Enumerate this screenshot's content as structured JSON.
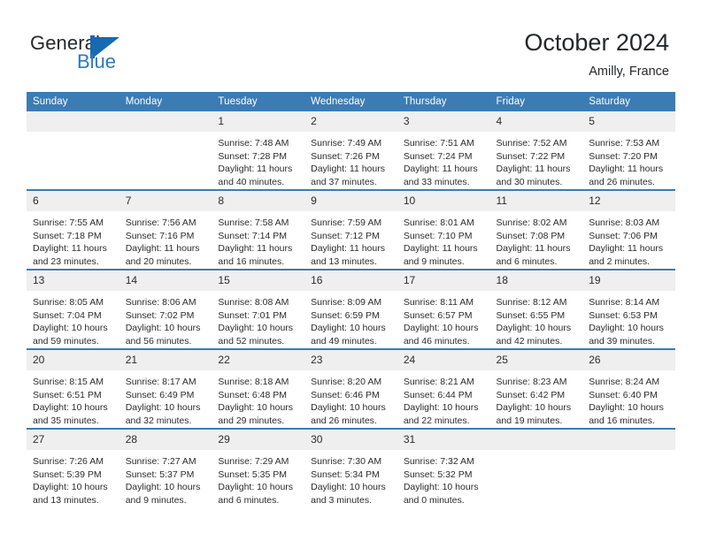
{
  "brand": {
    "name_part1": "General",
    "name_part2": "Blue",
    "logo_icon": "general-blue-triangle-logo",
    "accent_color": "#2a7ac0"
  },
  "header": {
    "title": "October 2024",
    "location": "Amilly, France",
    "header_bg_color": "#3b7cb5",
    "daynum_bg_color": "#efefef"
  },
  "weekday_headers": [
    "Sunday",
    "Monday",
    "Tuesday",
    "Wednesday",
    "Thursday",
    "Friday",
    "Saturday"
  ],
  "weeks": [
    [
      {
        "day": "",
        "lines": []
      },
      {
        "day": "",
        "lines": []
      },
      {
        "day": "1",
        "lines": [
          "Sunrise: 7:48 AM",
          "Sunset: 7:28 PM",
          "Daylight: 11 hours",
          "and 40 minutes."
        ]
      },
      {
        "day": "2",
        "lines": [
          "Sunrise: 7:49 AM",
          "Sunset: 7:26 PM",
          "Daylight: 11 hours",
          "and 37 minutes."
        ]
      },
      {
        "day": "3",
        "lines": [
          "Sunrise: 7:51 AM",
          "Sunset: 7:24 PM",
          "Daylight: 11 hours",
          "and 33 minutes."
        ]
      },
      {
        "day": "4",
        "lines": [
          "Sunrise: 7:52 AM",
          "Sunset: 7:22 PM",
          "Daylight: 11 hours",
          "and 30 minutes."
        ]
      },
      {
        "day": "5",
        "lines": [
          "Sunrise: 7:53 AM",
          "Sunset: 7:20 PM",
          "Daylight: 11 hours",
          "and 26 minutes."
        ]
      }
    ],
    [
      {
        "day": "6",
        "lines": [
          "Sunrise: 7:55 AM",
          "Sunset: 7:18 PM",
          "Daylight: 11 hours",
          "and 23 minutes."
        ]
      },
      {
        "day": "7",
        "lines": [
          "Sunrise: 7:56 AM",
          "Sunset: 7:16 PM",
          "Daylight: 11 hours",
          "and 20 minutes."
        ]
      },
      {
        "day": "8",
        "lines": [
          "Sunrise: 7:58 AM",
          "Sunset: 7:14 PM",
          "Daylight: 11 hours",
          "and 16 minutes."
        ]
      },
      {
        "day": "9",
        "lines": [
          "Sunrise: 7:59 AM",
          "Sunset: 7:12 PM",
          "Daylight: 11 hours",
          "and 13 minutes."
        ]
      },
      {
        "day": "10",
        "lines": [
          "Sunrise: 8:01 AM",
          "Sunset: 7:10 PM",
          "Daylight: 11 hours",
          "and 9 minutes."
        ]
      },
      {
        "day": "11",
        "lines": [
          "Sunrise: 8:02 AM",
          "Sunset: 7:08 PM",
          "Daylight: 11 hours",
          "and 6 minutes."
        ]
      },
      {
        "day": "12",
        "lines": [
          "Sunrise: 8:03 AM",
          "Sunset: 7:06 PM",
          "Daylight: 11 hours",
          "and 2 minutes."
        ]
      }
    ],
    [
      {
        "day": "13",
        "lines": [
          "Sunrise: 8:05 AM",
          "Sunset: 7:04 PM",
          "Daylight: 10 hours",
          "and 59 minutes."
        ]
      },
      {
        "day": "14",
        "lines": [
          "Sunrise: 8:06 AM",
          "Sunset: 7:02 PM",
          "Daylight: 10 hours",
          "and 56 minutes."
        ]
      },
      {
        "day": "15",
        "lines": [
          "Sunrise: 8:08 AM",
          "Sunset: 7:01 PM",
          "Daylight: 10 hours",
          "and 52 minutes."
        ]
      },
      {
        "day": "16",
        "lines": [
          "Sunrise: 8:09 AM",
          "Sunset: 6:59 PM",
          "Daylight: 10 hours",
          "and 49 minutes."
        ]
      },
      {
        "day": "17",
        "lines": [
          "Sunrise: 8:11 AM",
          "Sunset: 6:57 PM",
          "Daylight: 10 hours",
          "and 46 minutes."
        ]
      },
      {
        "day": "18",
        "lines": [
          "Sunrise: 8:12 AM",
          "Sunset: 6:55 PM",
          "Daylight: 10 hours",
          "and 42 minutes."
        ]
      },
      {
        "day": "19",
        "lines": [
          "Sunrise: 8:14 AM",
          "Sunset: 6:53 PM",
          "Daylight: 10 hours",
          "and 39 minutes."
        ]
      }
    ],
    [
      {
        "day": "20",
        "lines": [
          "Sunrise: 8:15 AM",
          "Sunset: 6:51 PM",
          "Daylight: 10 hours",
          "and 35 minutes."
        ]
      },
      {
        "day": "21",
        "lines": [
          "Sunrise: 8:17 AM",
          "Sunset: 6:49 PM",
          "Daylight: 10 hours",
          "and 32 minutes."
        ]
      },
      {
        "day": "22",
        "lines": [
          "Sunrise: 8:18 AM",
          "Sunset: 6:48 PM",
          "Daylight: 10 hours",
          "and 29 minutes."
        ]
      },
      {
        "day": "23",
        "lines": [
          "Sunrise: 8:20 AM",
          "Sunset: 6:46 PM",
          "Daylight: 10 hours",
          "and 26 minutes."
        ]
      },
      {
        "day": "24",
        "lines": [
          "Sunrise: 8:21 AM",
          "Sunset: 6:44 PM",
          "Daylight: 10 hours",
          "and 22 minutes."
        ]
      },
      {
        "day": "25",
        "lines": [
          "Sunrise: 8:23 AM",
          "Sunset: 6:42 PM",
          "Daylight: 10 hours",
          "and 19 minutes."
        ]
      },
      {
        "day": "26",
        "lines": [
          "Sunrise: 8:24 AM",
          "Sunset: 6:40 PM",
          "Daylight: 10 hours",
          "and 16 minutes."
        ]
      }
    ],
    [
      {
        "day": "27",
        "lines": [
          "Sunrise: 7:26 AM",
          "Sunset: 5:39 PM",
          "Daylight: 10 hours",
          "and 13 minutes."
        ]
      },
      {
        "day": "28",
        "lines": [
          "Sunrise: 7:27 AM",
          "Sunset: 5:37 PM",
          "Daylight: 10 hours",
          "and 9 minutes."
        ]
      },
      {
        "day": "29",
        "lines": [
          "Sunrise: 7:29 AM",
          "Sunset: 5:35 PM",
          "Daylight: 10 hours",
          "and 6 minutes."
        ]
      },
      {
        "day": "30",
        "lines": [
          "Sunrise: 7:30 AM",
          "Sunset: 5:34 PM",
          "Daylight: 10 hours",
          "and 3 minutes."
        ]
      },
      {
        "day": "31",
        "lines": [
          "Sunrise: 7:32 AM",
          "Sunset: 5:32 PM",
          "Daylight: 10 hours",
          "and 0 minutes."
        ]
      },
      {
        "day": "",
        "lines": []
      },
      {
        "day": "",
        "lines": []
      }
    ]
  ]
}
